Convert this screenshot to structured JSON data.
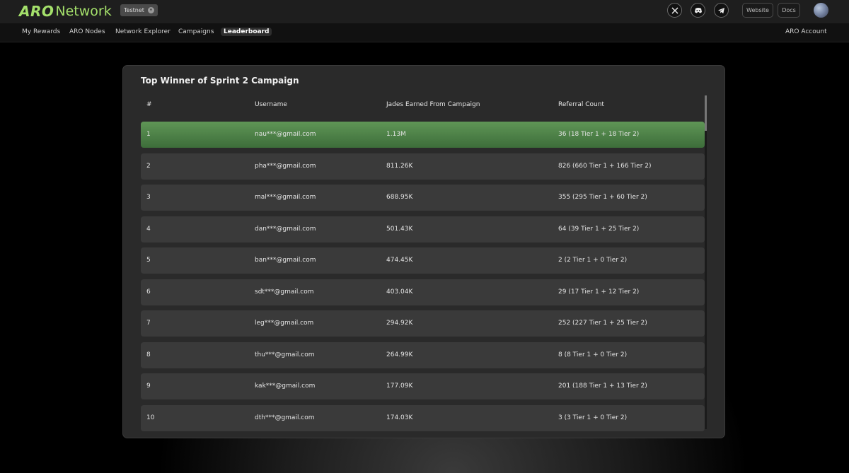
{
  "brand": {
    "logo_aro": "ARO",
    "logo_network": "Network"
  },
  "network_badge": {
    "label": "Testnet"
  },
  "header": {
    "social_icons": [
      "x-icon",
      "discord-icon",
      "telegram-icon"
    ],
    "website_label": "Website",
    "docs_label": "Docs"
  },
  "nav": {
    "items": [
      {
        "label": "My Rewards"
      },
      {
        "label": "ARO Nodes"
      },
      {
        "label": "Network Explorer"
      },
      {
        "label": "Campaigns"
      },
      {
        "label": "Leaderboard"
      }
    ],
    "active": "Leaderboard",
    "account_label": "ARO Account"
  },
  "leaderboard": {
    "title": "Top Winner of Sprint 2 Campaign",
    "columns": [
      "#",
      "Username",
      "Jades Earned From Campaign",
      "Referral Count"
    ],
    "rows": [
      {
        "rank": "1",
        "username": "nau***@gmail.com",
        "jades": "1.13M",
        "referrals": "36 (18 Tier 1 + 18 Tier 2)"
      },
      {
        "rank": "2",
        "username": "pha***@gmail.com",
        "jades": "811.26K",
        "referrals": "826 (660 Tier 1 + 166 Tier 2)"
      },
      {
        "rank": "3",
        "username": "mal***@gmail.com",
        "jades": "688.95K",
        "referrals": "355 (295 Tier 1 + 60 Tier 2)"
      },
      {
        "rank": "4",
        "username": "dan***@gmail.com",
        "jades": "501.43K",
        "referrals": "64 (39 Tier 1 + 25 Tier 2)"
      },
      {
        "rank": "5",
        "username": "ban***@gmail.com",
        "jades": "474.45K",
        "referrals": "2 (2 Tier 1 + 0 Tier 2)"
      },
      {
        "rank": "6",
        "username": "sdt***@gmail.com",
        "jades": "403.04K",
        "referrals": "29 (17 Tier 1 + 12 Tier 2)"
      },
      {
        "rank": "7",
        "username": "leg***@gmail.com",
        "jades": "294.92K",
        "referrals": "252 (227 Tier 1 + 25 Tier 2)"
      },
      {
        "rank": "8",
        "username": "thu***@gmail.com",
        "jades": "264.99K",
        "referrals": "8 (8 Tier 1 + 0 Tier 2)"
      },
      {
        "rank": "9",
        "username": "kak***@gmail.com",
        "jades": "177.09K",
        "referrals": "201 (188 Tier 1 + 13 Tier 2)"
      },
      {
        "rank": "10",
        "username": "dth***@gmail.com",
        "jades": "174.03K",
        "referrals": "3 (3 Tier 1 + 0 Tier 2)"
      }
    ]
  },
  "colors": {
    "brand_green": "#a4e06b",
    "top_row_green": "#5f9656"
  }
}
